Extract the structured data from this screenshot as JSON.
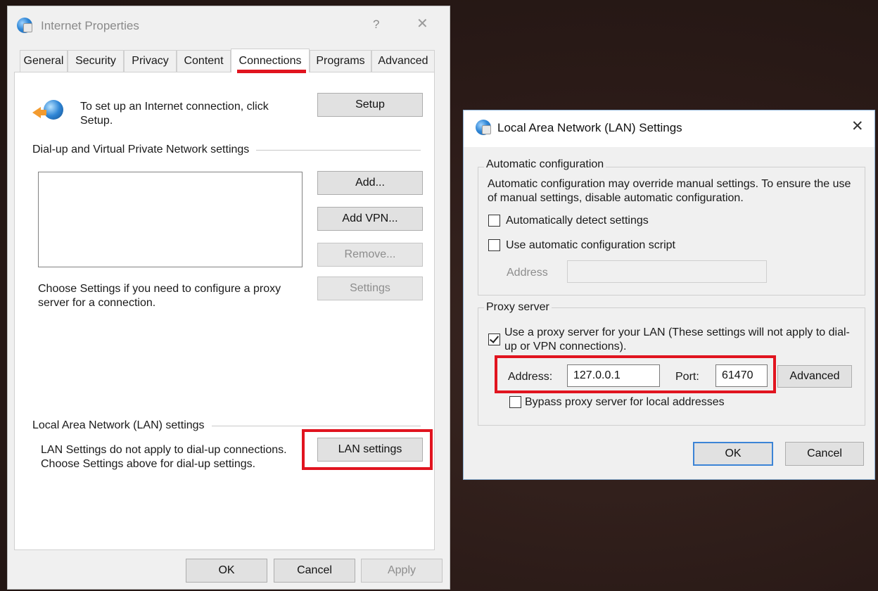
{
  "ip": {
    "title": "Internet Properties",
    "help_glyph": "?",
    "close_glyph": "✕",
    "tabs": [
      "General",
      "Security",
      "Privacy",
      "Content",
      "Connections",
      "Programs",
      "Advanced"
    ],
    "setup_text": "To set up an Internet connection, click Setup.",
    "setup_button": "Setup",
    "dialup_group": "Dial-up and Virtual Private Network settings",
    "add_button": "Add...",
    "add_vpn_button": "Add VPN...",
    "remove_button": "Remove...",
    "settings_button": "Settings",
    "proxy_text": "Choose Settings if you need to configure a proxy server for a connection.",
    "lan_group": "Local Area Network (LAN) settings",
    "lan_text": "LAN Settings do not apply to dial-up connections. Choose Settings above for dial-up settings.",
    "lan_button": "LAN settings",
    "ok": "OK",
    "cancel": "Cancel",
    "apply": "Apply"
  },
  "lan": {
    "title": "Local Area Network (LAN) Settings",
    "close_glyph": "✕",
    "auto_group": "Automatic configuration",
    "auto_text": "Automatic configuration may override manual settings.  To ensure the use of manual settings, disable automatic configuration.",
    "detect_label": "Automatically detect settings",
    "detect_checked": false,
    "script_label": "Use automatic configuration script",
    "script_checked": false,
    "script_address_label": "Address",
    "script_address_value": "",
    "proxy_group": "Proxy server",
    "use_proxy_label": "Use a proxy server for your LAN (These settings will not apply to dial-up or VPN connections).",
    "use_proxy_checked": true,
    "address_label": "Address:",
    "address_value": "127.0.0.1",
    "port_label": "Port:",
    "port_value": "61470",
    "advanced_button": "Advanced",
    "bypass_label": "Bypass proxy server for local addresses",
    "bypass_checked": false,
    "ok": "OK",
    "cancel": "Cancel"
  },
  "colors": {
    "highlight": "#e1141f",
    "background": "#2a1a17",
    "dialog": "#f0f0f0"
  }
}
